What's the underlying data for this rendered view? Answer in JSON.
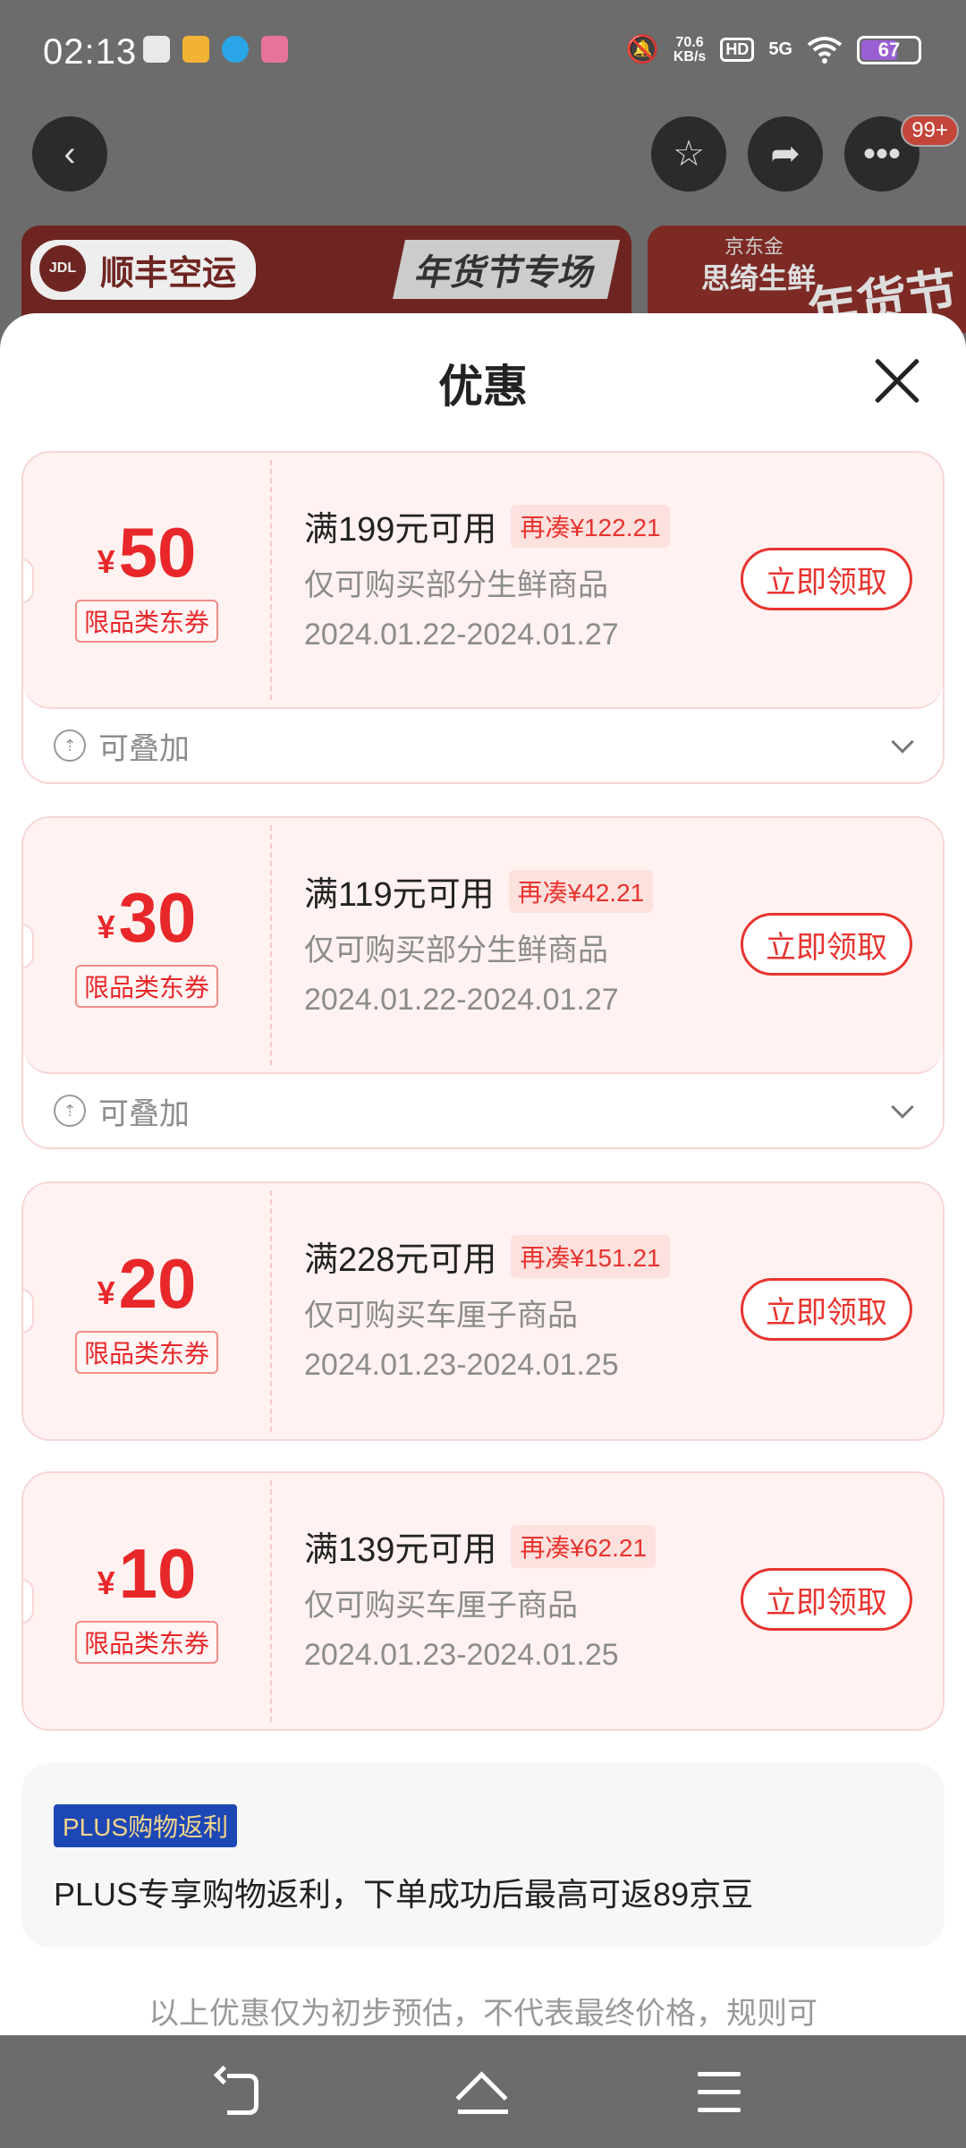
{
  "status_bar": {
    "time": "02:13",
    "speed_value": "70.6",
    "speed_unit": "KB/s",
    "hd": "HD",
    "network": "5G",
    "battery": "67"
  },
  "header": {
    "badge_count": "99+"
  },
  "banners": {
    "left_brand": "顺丰空运",
    "left_title": "年货节专场",
    "right_small": "京东金",
    "right_line": "思绮生鲜",
    "right_big": "年货节"
  },
  "sheet": {
    "title": "优惠"
  },
  "coupons": [
    {
      "currency": "¥",
      "amount": "50",
      "category": "限品类东券",
      "condition": "满199元可用",
      "more": "再凑¥122.21",
      "scope": "仅可购买部分生鲜商品",
      "dates": "2024.01.22-2024.01.27",
      "button": "立即领取",
      "stack": "可叠加"
    },
    {
      "currency": "¥",
      "amount": "30",
      "category": "限品类东券",
      "condition": "满119元可用",
      "more": "再凑¥42.21",
      "scope": "仅可购买部分生鲜商品",
      "dates": "2024.01.22-2024.01.27",
      "button": "立即领取",
      "stack": "可叠加"
    },
    {
      "currency": "¥",
      "amount": "20",
      "category": "限品类东券",
      "condition": "满228元可用",
      "more": "再凑¥151.21",
      "scope": "仅可购买车厘子商品",
      "dates": "2024.01.23-2024.01.25",
      "button": "立即领取"
    },
    {
      "currency": "¥",
      "amount": "10",
      "category": "限品类东券",
      "condition": "满139元可用",
      "more": "再凑¥62.21",
      "scope": "仅可购买车厘子商品",
      "dates": "2024.01.23-2024.01.25",
      "button": "立即领取"
    }
  ],
  "plus": {
    "tag": "PLUS购物返利",
    "text": "PLUS专享购物返利，下单成功后最高可返89京豆"
  },
  "footnote": "以上优惠仅为初步预估，不代表最终价格，规则可"
}
